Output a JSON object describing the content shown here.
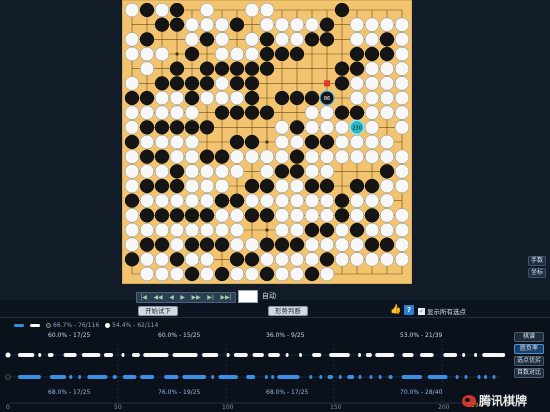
{
  "nav": {
    "buttons": [
      "|◀",
      "◀◀",
      "◀",
      "▶",
      "▶▶",
      "▶|",
      "▶▶|"
    ],
    "move_value": "",
    "auto_label": "自动"
  },
  "actions": {
    "trial_label": "开始试下",
    "territory_label": "形势判断",
    "show_all_label": "显示所有选点",
    "show_all_checked": "✓"
  },
  "side_buttons": {
    "top": "手数",
    "bottom": "坐标"
  },
  "board": {
    "label_a": "86",
    "label_b": "230",
    "black_stones": [
      [
        1,
        0
      ],
      [
        2,
        1
      ],
      [
        1,
        2
      ],
      [
        3,
        0
      ],
      [
        3,
        1
      ],
      [
        5,
        2
      ],
      [
        4,
        3
      ],
      [
        3,
        4
      ],
      [
        2,
        5
      ],
      [
        3,
        5
      ],
      [
        4,
        5
      ],
      [
        5,
        4
      ],
      [
        5,
        5
      ],
      [
        6,
        4
      ],
      [
        7,
        4
      ],
      [
        7,
        5
      ],
      [
        8,
        5
      ],
      [
        8,
        4
      ],
      [
        9,
        3
      ],
      [
        9,
        4
      ],
      [
        10,
        3
      ],
      [
        11,
        3
      ],
      [
        12,
        2
      ],
      [
        13,
        2
      ],
      [
        14,
        0
      ],
      [
        13,
        1
      ],
      [
        15,
        3
      ],
      [
        16,
        3
      ],
      [
        17,
        2
      ],
      [
        17,
        3
      ],
      [
        15,
        4
      ],
      [
        14,
        4
      ],
      [
        14,
        5
      ],
      [
        13,
        6
      ],
      [
        12,
        6
      ],
      [
        11,
        6
      ],
      [
        10,
        6
      ],
      [
        9,
        7
      ],
      [
        8,
        6
      ],
      [
        8,
        7
      ],
      [
        7,
        7
      ],
      [
        6,
        7
      ],
      [
        5,
        8
      ],
      [
        4,
        8
      ],
      [
        3,
        8
      ],
      [
        2,
        8
      ],
      [
        1,
        8
      ],
      [
        0,
        9
      ],
      [
        1,
        10
      ],
      [
        2,
        10
      ],
      [
        3,
        11
      ],
      [
        3,
        12
      ],
      [
        2,
        12
      ],
      [
        1,
        12
      ],
      [
        0,
        13
      ],
      [
        1,
        14
      ],
      [
        2,
        14
      ],
      [
        3,
        14
      ],
      [
        4,
        14
      ],
      [
        5,
        14
      ],
      [
        6,
        13
      ],
      [
        7,
        13
      ],
      [
        8,
        12
      ],
      [
        9,
        12
      ],
      [
        10,
        11
      ],
      [
        11,
        11
      ],
      [
        12,
        12
      ],
      [
        13,
        12
      ],
      [
        14,
        13
      ],
      [
        14,
        14
      ],
      [
        13,
        15
      ],
      [
        12,
        15
      ],
      [
        11,
        16
      ],
      [
        10,
        16
      ],
      [
        9,
        16
      ],
      [
        8,
        17
      ],
      [
        7,
        17
      ],
      [
        6,
        16
      ],
      [
        5,
        16
      ],
      [
        4,
        16
      ],
      [
        3,
        17
      ],
      [
        1,
        16
      ],
      [
        2,
        16
      ],
      [
        0,
        17
      ],
      [
        15,
        15
      ],
      [
        16,
        16
      ],
      [
        17,
        16
      ],
      [
        16,
        14
      ],
      [
        15,
        12
      ],
      [
        16,
        12
      ],
      [
        17,
        11
      ],
      [
        13,
        9
      ],
      [
        12,
        9
      ],
      [
        11,
        8
      ],
      [
        14,
        7
      ],
      [
        15,
        7
      ],
      [
        11,
        10
      ],
      [
        5,
        10
      ],
      [
        6,
        10
      ],
      [
        7,
        9
      ],
      [
        8,
        9
      ],
      [
        0,
        6
      ],
      [
        1,
        6
      ],
      [
        4,
        6
      ],
      [
        9,
        2
      ],
      [
        7,
        1
      ],
      [
        9,
        14
      ],
      [
        8,
        14
      ],
      [
        9,
        18
      ],
      [
        12,
        18
      ],
      [
        13,
        17
      ],
      [
        4,
        18
      ],
      [
        6,
        18
      ]
    ],
    "white_stones": [
      [
        0,
        0
      ],
      [
        0,
        2
      ],
      [
        2,
        0
      ],
      [
        0,
        3
      ],
      [
        1,
        3
      ],
      [
        2,
        3
      ],
      [
        1,
        4
      ],
      [
        0,
        5
      ],
      [
        2,
        6
      ],
      [
        3,
        6
      ],
      [
        4,
        7
      ],
      [
        3,
        7
      ],
      [
        5,
        6
      ],
      [
        6,
        6
      ],
      [
        6,
        5
      ],
      [
        7,
        6
      ],
      [
        6,
        3
      ],
      [
        7,
        3
      ],
      [
        8,
        3
      ],
      [
        8,
        2
      ],
      [
        9,
        1
      ],
      [
        10,
        1
      ],
      [
        10,
        2
      ],
      [
        11,
        2
      ],
      [
        11,
        1
      ],
      [
        12,
        1
      ],
      [
        5,
        1
      ],
      [
        6,
        1
      ],
      [
        6,
        2
      ],
      [
        4,
        2
      ],
      [
        4,
        1
      ],
      [
        5,
        0
      ],
      [
        8,
        0
      ],
      [
        9,
        0
      ],
      [
        0,
        7
      ],
      [
        1,
        7
      ],
      [
        2,
        7
      ],
      [
        0,
        8
      ],
      [
        1,
        9
      ],
      [
        2,
        9
      ],
      [
        3,
        9
      ],
      [
        4,
        9
      ],
      [
        3,
        10
      ],
      [
        4,
        10
      ],
      [
        4,
        11
      ],
      [
        4,
        12
      ],
      [
        5,
        12
      ],
      [
        6,
        12
      ],
      [
        6,
        11
      ],
      [
        7,
        11
      ],
      [
        7,
        10
      ],
      [
        8,
        10
      ],
      [
        9,
        10
      ],
      [
        9,
        11
      ],
      [
        10,
        10
      ],
      [
        10,
        9
      ],
      [
        10,
        8
      ],
      [
        11,
        9
      ],
      [
        12,
        8
      ],
      [
        12,
        7
      ],
      [
        13,
        7
      ],
      [
        13,
        8
      ],
      [
        14,
        8
      ],
      [
        15,
        8
      ],
      [
        16,
        8
      ],
      [
        16,
        7
      ],
      [
        17,
        7
      ],
      [
        17,
        6
      ],
      [
        16,
        6
      ],
      [
        15,
        6
      ],
      [
        15,
        5
      ],
      [
        16,
        5
      ],
      [
        17,
        5
      ],
      [
        18,
        5
      ],
      [
        18,
        4
      ],
      [
        17,
        4
      ],
      [
        16,
        4
      ],
      [
        16,
        2
      ],
      [
        15,
        2
      ],
      [
        15,
        1
      ],
      [
        16,
        1
      ],
      [
        17,
        1
      ],
      [
        18,
        1
      ],
      [
        18,
        2
      ],
      [
        18,
        3
      ],
      [
        18,
        6
      ],
      [
        18,
        7
      ],
      [
        18,
        8
      ],
      [
        17,
        9
      ],
      [
        16,
        9
      ],
      [
        15,
        9
      ],
      [
        14,
        9
      ],
      [
        14,
        10
      ],
      [
        15,
        10
      ],
      [
        16,
        10
      ],
      [
        17,
        10
      ],
      [
        18,
        10
      ],
      [
        18,
        11
      ],
      [
        18,
        12
      ],
      [
        17,
        12
      ],
      [
        17,
        13
      ],
      [
        16,
        13
      ],
      [
        15,
        13
      ],
      [
        15,
        14
      ],
      [
        14,
        15
      ],
      [
        14,
        16
      ],
      [
        13,
        16
      ],
      [
        12,
        16
      ],
      [
        12,
        17
      ],
      [
        11,
        17
      ],
      [
        10,
        17
      ],
      [
        9,
        17
      ],
      [
        8,
        16
      ],
      [
        7,
        16
      ],
      [
        7,
        15
      ],
      [
        6,
        15
      ],
      [
        5,
        15
      ],
      [
        4,
        15
      ],
      [
        3,
        15
      ],
      [
        2,
        15
      ],
      [
        1,
        15
      ],
      [
        0,
        15
      ],
      [
        0,
        16
      ],
      [
        0,
        14
      ],
      [
        1,
        13
      ],
      [
        2,
        13
      ],
      [
        3,
        13
      ],
      [
        4,
        13
      ],
      [
        5,
        13
      ],
      [
        0,
        12
      ],
      [
        0,
        11
      ],
      [
        1,
        11
      ],
      [
        2,
        11
      ],
      [
        0,
        10
      ],
      [
        5,
        11
      ],
      [
        6,
        14
      ],
      [
        7,
        14
      ],
      [
        8,
        13
      ],
      [
        9,
        13
      ],
      [
        10,
        13
      ],
      [
        10,
        12
      ],
      [
        11,
        12
      ],
      [
        11,
        13
      ],
      [
        12,
        13
      ],
      [
        13,
        13
      ],
      [
        13,
        14
      ],
      [
        12,
        14
      ],
      [
        11,
        14
      ],
      [
        10,
        14
      ],
      [
        10,
        15
      ],
      [
        11,
        15
      ],
      [
        12,
        11
      ],
      [
        13,
        11
      ],
      [
        13,
        10
      ],
      [
        12,
        10
      ],
      [
        16,
        15
      ],
      [
        17,
        15
      ],
      [
        17,
        14
      ],
      [
        18,
        14
      ],
      [
        18,
        15
      ],
      [
        18,
        16
      ],
      [
        18,
        17
      ],
      [
        17,
        17
      ],
      [
        16,
        17
      ],
      [
        15,
        17
      ],
      [
        15,
        16
      ],
      [
        14,
        17
      ],
      [
        13,
        18
      ],
      [
        11,
        18
      ],
      [
        10,
        18
      ],
      [
        8,
        18
      ],
      [
        7,
        18
      ],
      [
        5,
        18
      ],
      [
        5,
        17
      ],
      [
        4,
        17
      ],
      [
        3,
        16
      ],
      [
        2,
        17
      ],
      [
        1,
        17
      ],
      [
        1,
        18
      ],
      [
        2,
        18
      ],
      [
        3,
        18
      ]
    ]
  },
  "analysis": {
    "legend": [
      {
        "label": "",
        "color": "#3b8fe8",
        "kind": "bar"
      },
      {
        "label": "",
        "color": "#ffffff",
        "kind": "bar"
      },
      {
        "label": "66.7% - 76/116",
        "color": "#2b2b2b",
        "kind": "dot"
      },
      {
        "label": "54.4% - 62/114",
        "color": "#ffffff",
        "kind": "dot"
      }
    ],
    "top_stats": [
      "60.0% - 17/25",
      "60.0% - 15/25",
      "36.0% - 9/25",
      "53.0% - 21/39"
    ],
    "bottom_stats": [
      "68.0% - 17/25",
      "76.0% - 19/25",
      "68.0% - 17/25",
      "70.0% - 28/40"
    ],
    "axis_ticks": [
      "0",
      "50",
      "100",
      "150",
      "200"
    ],
    "score_label": "229 9",
    "right_buttons": [
      "棋谱",
      "胜负率",
      "选点优劣",
      "目数对比"
    ],
    "right_active_index": 1
  },
  "watermark": {
    "text": "腾讯棋牌"
  }
}
